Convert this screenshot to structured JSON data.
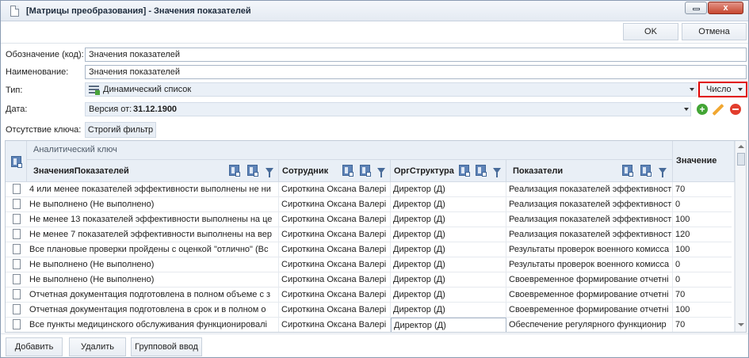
{
  "window": {
    "title": "[Матрицы преобразования] - Значения показателей",
    "close_glyph": "x"
  },
  "toolbar": {
    "ok_label": "OK",
    "cancel_label": "Отмена"
  },
  "form": {
    "code_label": "Обозначение (код):",
    "code_value": "Значения показателей",
    "name_label": "Наименование:",
    "name_value": "Значения показателей",
    "type_label": "Тип:",
    "type_value": "Динамический список",
    "number_type": "Число",
    "date_label": "Дата:",
    "date_prefix": "Версия от: ",
    "date_value": "31.12.1900",
    "missing_key_label": "Отсутствие ключа:",
    "missing_key_value": "Строгий фильтр"
  },
  "grid": {
    "group_header": "Аналитический ключ",
    "columns": [
      "ЗначенияПоказателей",
      "Сотрудник",
      "ОргСтруктура",
      "Показатели",
      "Значение"
    ],
    "rows": [
      {
        "c1": "4 или менее показателей эффективности выполнены не ни",
        "c2": "Сироткина Оксана Валері",
        "c3": "Директор (Д)",
        "c4": "Реализация показателей эффективності",
        "c5": "70"
      },
      {
        "c1": "Не выполнено (Не выполнено)",
        "c2": "Сироткина Оксана Валері",
        "c3": "Директор (Д)",
        "c4": "Реализация показателей эффективності",
        "c5": "0"
      },
      {
        "c1": "Не менее 13 показателей эффективности выполнены на це",
        "c2": "Сироткина Оксана Валері",
        "c3": "Директор (Д)",
        "c4": "Реализация показателей эффективності",
        "c5": "100"
      },
      {
        "c1": "Не менее 7 показателей эффективности выполнены на вер",
        "c2": "Сироткина Оксана Валері",
        "c3": "Директор (Д)",
        "c4": "Реализация показателей эффективності",
        "c5": "120"
      },
      {
        "c1": "Все плановые проверки пройдены с оценкой \"отлично\" (Вс",
        "c2": "Сироткина Оксана Валері",
        "c3": "Директор (Д)",
        "c4": "Результаты проверок военного комисса",
        "c5": "100"
      },
      {
        "c1": "Не выполнено (Не выполнено)",
        "c2": "Сироткина Оксана Валері",
        "c3": "Директор (Д)",
        "c4": "Результаты проверок военного комисса",
        "c5": "0"
      },
      {
        "c1": "Не выполнено (Не выполнено)",
        "c2": "Сироткина Оксана Валері",
        "c3": "Директор (Д)",
        "c4": "Своевременное формирование отчетні",
        "c5": "0"
      },
      {
        "c1": "Отчетная документация подготовлена в полном объеме с з",
        "c2": "Сироткина Оксана Валері",
        "c3": "Директор (Д)",
        "c4": "Своевременное формирование отчетні",
        "c5": "70"
      },
      {
        "c1": "Отчетная документация подготовлена в срок и в полном о",
        "c2": "Сироткина Оксана Валері",
        "c3": "Директор (Д)",
        "c4": "Своевременное формирование отчетні",
        "c5": "100"
      },
      {
        "c1": "Все пункты медицинского обслуживания функционировалі",
        "c2": "Сироткина Оксана Валері",
        "c3": "Директор (Д)",
        "c4": "Обеспечение регулярного функционир",
        "c5": "70"
      }
    ]
  },
  "bottom": {
    "add_label": "Добавить",
    "delete_label": "Удалить",
    "group_input_label": "Групповой ввод"
  }
}
